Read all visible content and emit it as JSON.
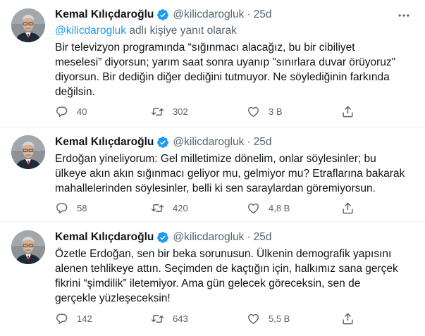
{
  "tweets": [
    {
      "name": "Kemal Kılıçdaroğlu",
      "handle": "@kilicdarogluk",
      "separator": "·",
      "time": "25d",
      "reply_mention": "@kilicdarogluk",
      "reply_suffix": " adlı kişiye yanıt olarak",
      "text": "Bir televizyon programında “sığınmacı alacağız, bu bir cibiliyet\nmeselesi” diyorsun; yarım saat sonra uyanıp \"sınırlara duvar örüyoruz\"\ndiyorsun. Bir dediğin diğer dediğini tutmuyor. Ne söylediğinin farkında\ndeğilsin.",
      "replies": "40",
      "retweets": "302",
      "likes": "3 B"
    },
    {
      "name": "Kemal Kılıçdaroğlu",
      "handle": "@kilicdarogluk",
      "separator": "·",
      "time": "25d",
      "text": "Erdoğan yineliyorum: Gel milletimize dönelim, onlar söylesinler; bu\nülkeye akın akın sığınmacı geliyor mu, gelmiyor mu? Etraflarına bakarak\nmahallelerinden söylesinler, belli ki sen saraylardan göremiyorsun.",
      "replies": "58",
      "retweets": "420",
      "likes": "4,8 B"
    },
    {
      "name": "Kemal Kılıçdaroğlu",
      "handle": "@kilicdarogluk",
      "separator": "·",
      "time": "25d",
      "text": "Özetle Erdoğan, sen bir beka sorunusun. Ülkenin demografik yapısını\nalenen tehlikeye attın. Seçimden de kaçtığın için, halkımız sana gerçek\nfikrini “şimdilik” iletemiyor. Ama gün gelecek göreceksin, sen de\ngerçekle yüzleşeceksin!",
      "replies": "142",
      "retweets": "643",
      "likes": "5,5 B"
    }
  ],
  "icons": {
    "verified": "verified-badge-icon",
    "more": "more-options-icon",
    "reply": "reply-icon",
    "retweet": "retweet-icon",
    "like": "heart-icon",
    "share": "share-icon"
  },
  "colors": {
    "accent": "#1d9bf0",
    "text": "#0f1419",
    "secondary": "#536471"
  }
}
